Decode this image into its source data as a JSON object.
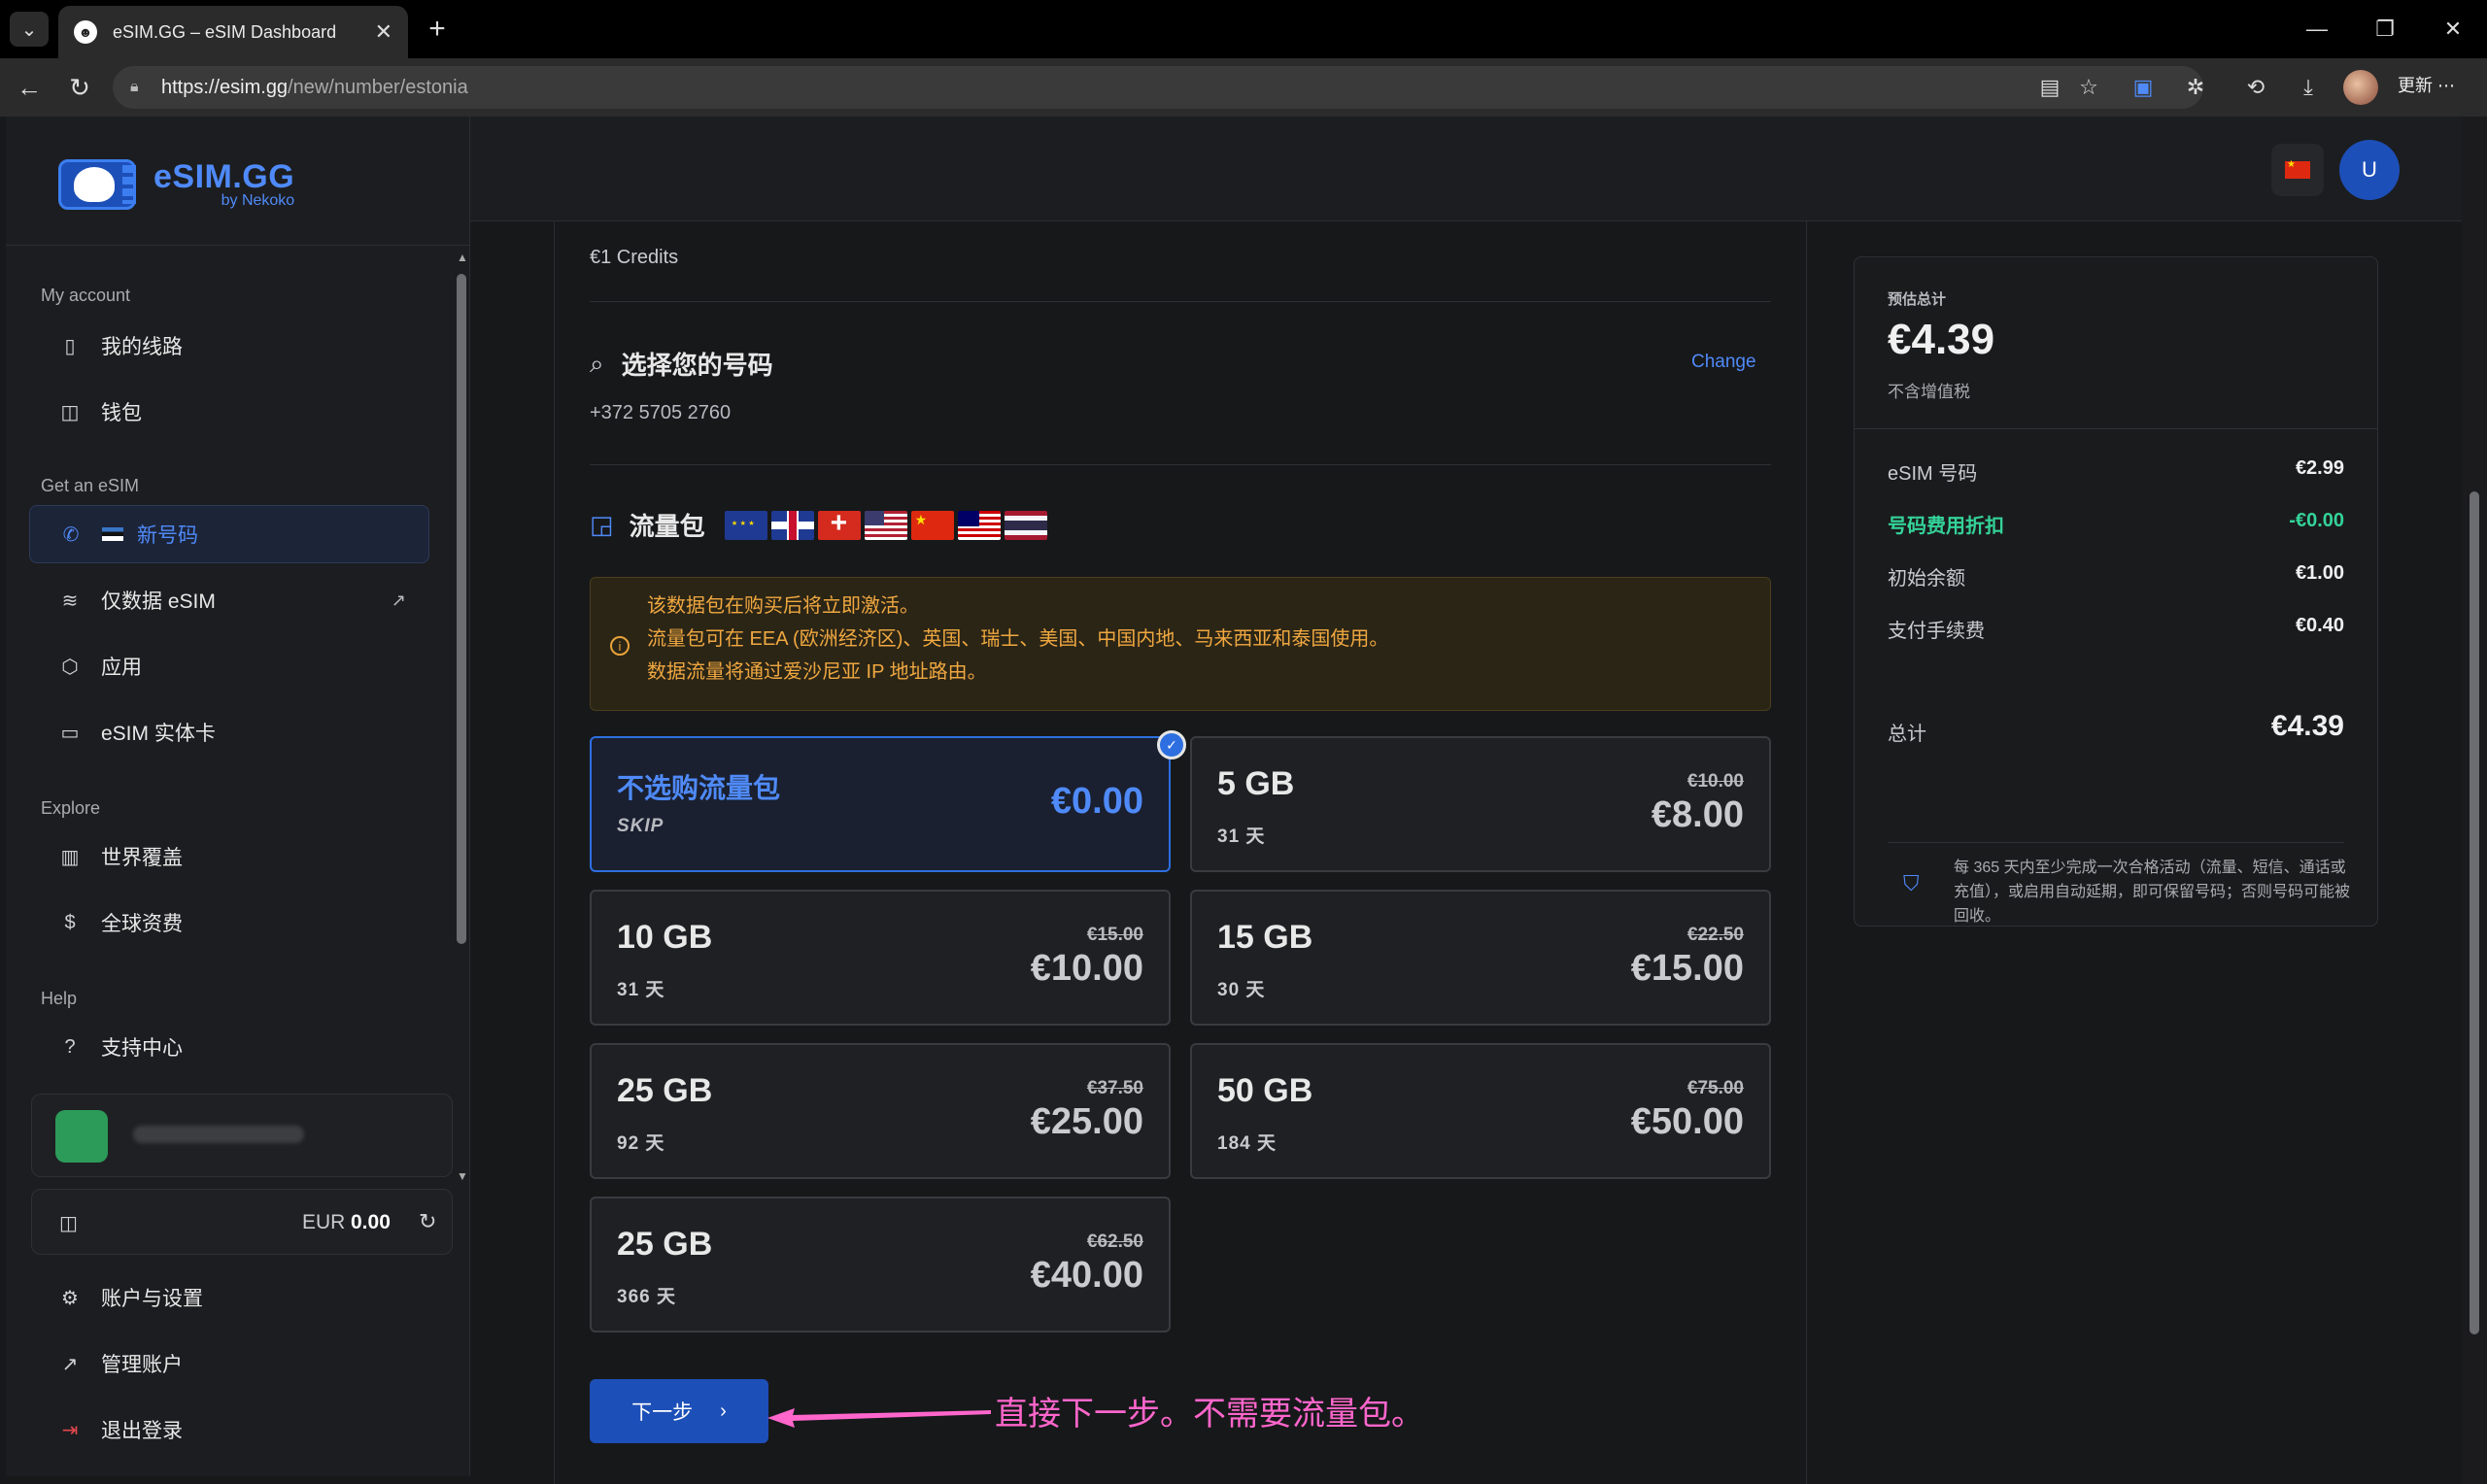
{
  "browser": {
    "tab_title": "eSIM.GG – eSIM Dashboard",
    "url_host": "https://esim.gg",
    "url_path": "/new/number/estonia",
    "update_label": "更新"
  },
  "brand": {
    "name": "eSIM.GG",
    "sub": "by Nekoko"
  },
  "sidebar": {
    "sections": [
      {
        "title": "My account",
        "items": [
          {
            "label": "我的线路",
            "icon": "phone-icon"
          },
          {
            "label": "钱包",
            "icon": "wallet-icon"
          }
        ]
      },
      {
        "title": "Get an eSIM",
        "items": [
          {
            "label": "新号码",
            "icon": "phone-call-icon",
            "active": true
          },
          {
            "label": "仅数据 eSIM",
            "icon": "wifi-icon",
            "external": true
          },
          {
            "label": "应用",
            "icon": "box-icon"
          },
          {
            "label": "eSIM 实体卡",
            "icon": "card-icon"
          }
        ]
      },
      {
        "title": "Explore",
        "items": [
          {
            "label": "世界覆盖",
            "icon": "map-icon"
          },
          {
            "label": "全球资费",
            "icon": "dollar-icon"
          }
        ]
      },
      {
        "title": "Help",
        "items": [
          {
            "label": "支持中心",
            "icon": "help-circle-icon"
          }
        ]
      }
    ],
    "wallet": {
      "currency": "EUR",
      "amount": "0.00"
    },
    "bottom_links": [
      {
        "label": "账户与设置",
        "icon": "gear-icon"
      },
      {
        "label": "管理账户",
        "icon": "external-link-icon"
      },
      {
        "label": "退出登录",
        "icon": "logout-icon"
      }
    ]
  },
  "header": {
    "avatar_letter": "U"
  },
  "main": {
    "credits_label": "€1 Credits",
    "number_section_title": "选择您的号码",
    "change_label": "Change",
    "phone_number": "+372 5705 2760",
    "data_section_title": "流量包",
    "notice_lines": [
      "该数据包在购买后将立即激活。",
      "流量包可在 EEA (欧洲经济区)、英国、瑞士、美国、中国内地、马来西亚和泰国使用。",
      "数据流量将通过爱沙尼亚 IP 地址路由。"
    ],
    "plans": [
      {
        "name": "不选购流量包",
        "days": "SKIP",
        "old_price": "",
        "price": "€0.00",
        "selected": true
      },
      {
        "name": "5 GB",
        "days": "31 天",
        "old_price": "€10.00",
        "price": "€8.00"
      },
      {
        "name": "10 GB",
        "days": "31 天",
        "old_price": "€15.00",
        "price": "€10.00"
      },
      {
        "name": "15 GB",
        "days": "30 天",
        "old_price": "€22.50",
        "price": "€15.00"
      },
      {
        "name": "25 GB",
        "days": "92 天",
        "old_price": "€37.50",
        "price": "€25.00"
      },
      {
        "name": "50 GB",
        "days": "184 天",
        "old_price": "€75.00",
        "price": "€50.00"
      },
      {
        "name": "25 GB",
        "days": "366 天",
        "old_price": "€62.50",
        "price": "€40.00"
      }
    ],
    "next_label": "下一步"
  },
  "summary": {
    "label": "预估总计",
    "total_big": "€4.39",
    "vat_note": "不含增值税",
    "rows": [
      {
        "label": "eSIM 号码",
        "value": "€2.99"
      },
      {
        "label": "号码费用折扣",
        "value": "-€0.00",
        "discount": true
      },
      {
        "label": "初始余额",
        "value": "€1.00"
      },
      {
        "label": "支付手续费",
        "value": "€0.40"
      }
    ],
    "total_label": "总计",
    "total_value": "€4.39",
    "note": "每 365 天内至少完成一次合格活动（流量、短信、通话或充值），或启用自动延期，即可保留号码；否则号码可能被回收。"
  },
  "annotation": {
    "text": "直接下一步。不需要流量包。",
    "color": "#ff66cc"
  }
}
